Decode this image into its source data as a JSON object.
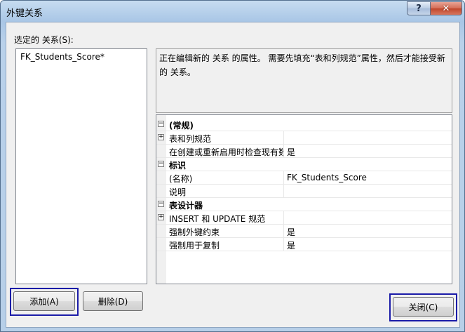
{
  "window": {
    "title": "外键关系",
    "help_label": "?",
    "close_label": "✕"
  },
  "relations": {
    "label": "选定的 关系(S):",
    "items": [
      "FK_Students_Score*"
    ]
  },
  "description": "正在编辑新的 关系 的属性。 需要先填充“表和列规范”属性，然后才能接受新的 关系。",
  "properties": [
    {
      "type": "category",
      "label": "(常规)",
      "expander": "⊟"
    },
    {
      "type": "prop",
      "label": "表和列规范",
      "value": "",
      "expander": "⊞"
    },
    {
      "type": "prop",
      "label": "在创建或重新启用时检查现有数",
      "value": "是",
      "expander": ""
    },
    {
      "type": "category",
      "label": "标识",
      "expander": "⊟"
    },
    {
      "type": "prop",
      "label": "(名称)",
      "value": "FK_Students_Score",
      "expander": ""
    },
    {
      "type": "prop",
      "label": "说明",
      "value": "",
      "expander": ""
    },
    {
      "type": "category",
      "label": "表设计器",
      "expander": "⊟"
    },
    {
      "type": "prop",
      "label": "INSERT 和 UPDATE 规范",
      "value": "",
      "expander": "⊞"
    },
    {
      "type": "prop",
      "label": "强制外键约束",
      "value": "是",
      "expander": ""
    },
    {
      "type": "prop",
      "label": "强制用于复制",
      "value": "是",
      "expander": ""
    }
  ],
  "buttons": {
    "add": "添加(A)",
    "delete": "删除(D)",
    "close": "关闭(C)"
  }
}
